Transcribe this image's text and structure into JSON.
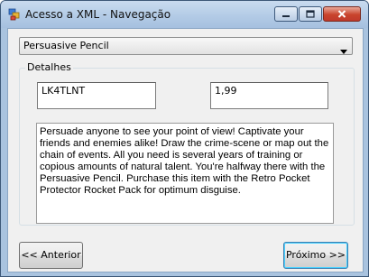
{
  "window": {
    "title": "Acesso a XML - Navegação"
  },
  "product_select": {
    "selected": "Persuasive Pencil"
  },
  "details": {
    "group_label": "Detalhes",
    "code": "LK4TLNT",
    "price": "1,99",
    "description": "Persuade anyone to see your point of view!  Captivate your friends and enemies alike!  Draw the crime-scene or map out the chain of events.  All you need is several years of training or copious amounts of natural talent. You're halfway there with the Persuasive Pencil. Purchase this item with the Retro Pocket Protector Rocket Pack for optimum disguise."
  },
  "navigation": {
    "prev_label": "<< Anterior",
    "next_label": "Próximo >>"
  },
  "icons": {
    "app": "app-window-icon",
    "minimize": "minimize-icon",
    "maximize": "maximize-icon",
    "close": "close-icon",
    "dropdown": "chevron-down-icon"
  }
}
